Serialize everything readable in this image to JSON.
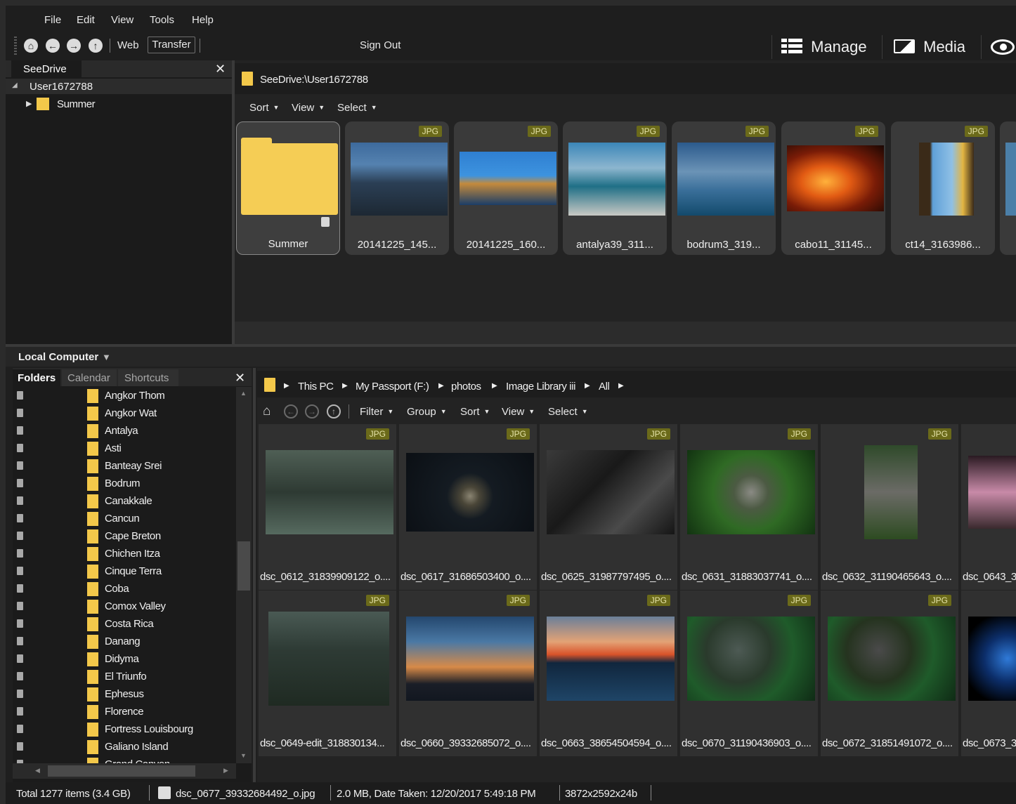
{
  "menu": {
    "file": "File",
    "edit": "Edit",
    "view": "View",
    "tools": "Tools",
    "help": "Help"
  },
  "toolbar": {
    "web": "Web",
    "transfer": "Transfer",
    "sign_out": "Sign Out",
    "manage": "Manage",
    "media": "Media"
  },
  "seedrive_tree": {
    "tab": "SeeDrive",
    "user": "User1672788",
    "child": "Summer"
  },
  "seedrive_browser": {
    "path": "SeeDrive:\\User1672788",
    "sort": "Sort",
    "view": "View",
    "select": "Select",
    "items": [
      {
        "caption": "Summer",
        "badge": ""
      },
      {
        "caption": "20141225_145...",
        "badge": "JPG"
      },
      {
        "caption": "20141225_160...",
        "badge": "JPG"
      },
      {
        "caption": "antalya39_311...",
        "badge": "JPG"
      },
      {
        "caption": "bodrum3_319...",
        "badge": "JPG"
      },
      {
        "caption": "cabo11_31145...",
        "badge": "JPG"
      },
      {
        "caption": "ct14_3163986...",
        "badge": "JPG"
      }
    ]
  },
  "local": {
    "header": "Local Computer",
    "tabs": {
      "folders": "Folders",
      "calendar": "Calendar",
      "shortcuts": "Shortcuts"
    },
    "folders": [
      "Angkor Thom",
      "Angkor Wat",
      "Antalya",
      "Asti",
      "Banteay Srei",
      "Bodrum",
      "Canakkale",
      "Cancun",
      "Cape Breton",
      "Chichen Itza",
      "Cinque Terra",
      "Coba",
      "Comox Valley",
      "Costa Rica",
      "Danang",
      "Didyma",
      "El Triunfo",
      "Ephesus",
      "Florence",
      "Fortress Louisbourg",
      "Galiano Island",
      "Grand Canyon"
    ],
    "breadcrumb": [
      "This PC",
      "My Passport (F:)",
      "photos",
      "Image Library iii",
      "All"
    ],
    "filter": "Filter",
    "group": "Group",
    "sort": "Sort",
    "view": "View",
    "select": "Select",
    "row1": [
      {
        "caption": "dsc_0612_31839909122_o....",
        "badge": "JPG"
      },
      {
        "caption": "dsc_0617_31686503400_o....",
        "badge": "JPG"
      },
      {
        "caption": "dsc_0625_31987797495_o....",
        "badge": "JPG"
      },
      {
        "caption": "dsc_0631_31883037741_o....",
        "badge": "JPG"
      },
      {
        "caption": "dsc_0632_31190465643_o....",
        "badge": "JPG"
      },
      {
        "caption": "dsc_0643_3",
        "badge": ""
      }
    ],
    "row2": [
      {
        "caption": "dsc_0649-edit_318830134...",
        "badge": "JPG"
      },
      {
        "caption": "dsc_0660_39332685072_o....",
        "badge": "JPG"
      },
      {
        "caption": "dsc_0663_38654504594_o....",
        "badge": "JPG"
      },
      {
        "caption": "dsc_0670_31190436903_o....",
        "badge": "JPG"
      },
      {
        "caption": "dsc_0672_31851491072_o....",
        "badge": "JPG"
      },
      {
        "caption": "dsc_0673_3",
        "badge": ""
      }
    ]
  },
  "status": {
    "total": "Total 1277 items  (3.4 GB)",
    "file": "dsc_0677_39332684492_o.jpg",
    "info": "2.0 MB, Date Taken: 12/20/2017 5:49:18 PM",
    "dims": "3872x2592x24b"
  }
}
